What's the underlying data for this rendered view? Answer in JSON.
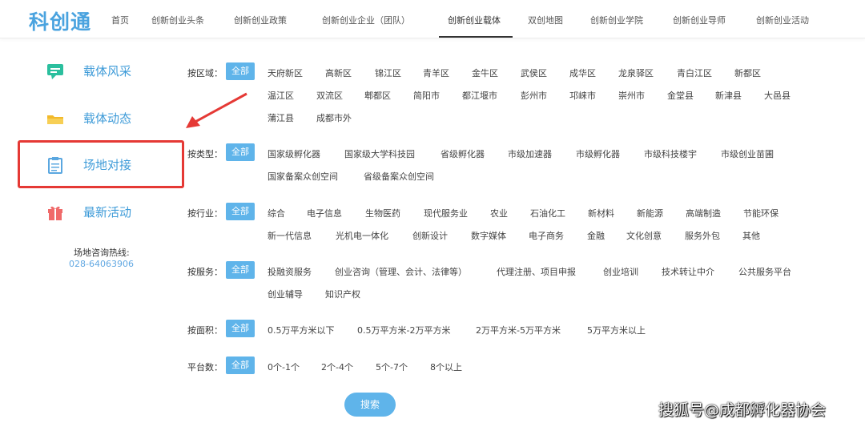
{
  "header": {
    "logo": "科创通",
    "nav": [
      "首页",
      "创新创业头条",
      "创新创业政策",
      "创新创业企业（团队）",
      "创新创业载体",
      "双创地图",
      "创新创业学院",
      "创新创业导师",
      "创新创业活动"
    ],
    "active_index": 4
  },
  "sidebar": {
    "items": [
      {
        "label": "载体风采",
        "icon": "chat-bubble-icon",
        "color": "#2bbf9e"
      },
      {
        "label": "载体动态",
        "icon": "folder-icon",
        "color": "#f2b92a"
      },
      {
        "label": "场地对接",
        "icon": "clipboard-icon",
        "color": "#5aa7e0"
      },
      {
        "label": "最新活动",
        "icon": "gift-icon",
        "color": "#f06a6a"
      }
    ],
    "active_index": 2,
    "hotline_title": "场地咨询热线:",
    "hotline_number": "028-64063906"
  },
  "filters": {
    "all_label": "全部",
    "rows": [
      {
        "label": "按区域：",
        "lines": [
          [
            "天府新区",
            "高新区",
            "锦江区",
            "青羊区",
            "金牛区",
            "武侯区",
            "成华区",
            "龙泉驿区",
            "青白江区",
            "新都区"
          ],
          [
            "温江区",
            "双流区",
            "郫都区",
            "简阳市",
            "都江堰市",
            "彭州市",
            "邛崃市",
            "崇州市",
            "金堂县",
            "新津县",
            "大邑县"
          ],
          [
            "蒲江县",
            "成都市外"
          ]
        ]
      },
      {
        "label": "按类型：",
        "lines": [
          [
            "国家级孵化器",
            "国家级大学科技园",
            "省级孵化器",
            "市级加速器",
            "市级孵化器",
            "市级科技楼宇",
            "市级创业苗圃"
          ],
          [
            "国家备案众创空间",
            "省级备案众创空间"
          ]
        ]
      },
      {
        "label": "按行业：",
        "lines": [
          [
            "综合",
            "电子信息",
            "生物医药",
            "现代服务业",
            "农业",
            "石油化工",
            "新材料",
            "新能源",
            "高端制造",
            "节能环保"
          ],
          [
            "新一代信息",
            "光机电一体化",
            "创新设计",
            "数字媒体",
            "电子商务",
            "金融",
            "文化创意",
            "服务外包",
            "其他"
          ]
        ]
      },
      {
        "label": "按服务：",
        "lines": [
          [
            "投融资服务",
            "创业咨询（管理、会计、法律等）",
            "代理注册、项目申报",
            "创业培训",
            "技术转让中介",
            "公共服务平台"
          ],
          [
            "创业辅导",
            "知识产权"
          ]
        ]
      },
      {
        "label": "按面积：",
        "lines": [
          [
            "0.5万平方米以下",
            "0.5万平方米-2万平方米",
            "2万平方米-5万平方米",
            "5万平方米以上"
          ]
        ]
      },
      {
        "label": "平台数：",
        "lines": [
          [
            "0个-1个",
            "2个-4个",
            "5个-7个",
            "8个以上"
          ]
        ]
      }
    ]
  },
  "search_label": "搜索",
  "watermark": "搜狐号@成都孵化器协会",
  "colors": {
    "accent": "#5fb4ea",
    "highlight_border": "#e53935"
  }
}
